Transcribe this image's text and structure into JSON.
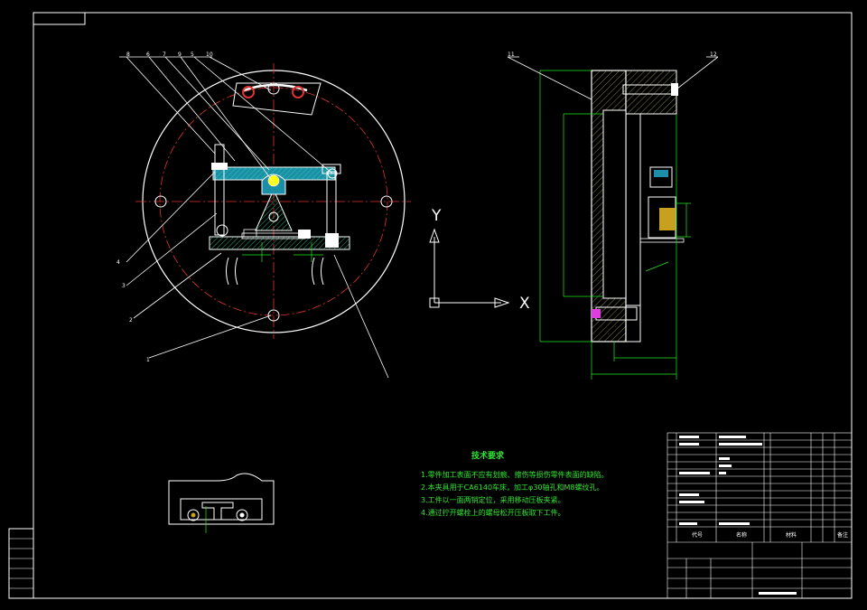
{
  "axis_labels": {
    "y": "Y",
    "x": "X"
  },
  "leaders_left": {
    "l8": "8",
    "l6": "6",
    "l7": "7",
    "l9": "9",
    "l5": "5",
    "l10": "10",
    "l4": "4",
    "l3": "3",
    "l2": "2",
    "l1": "1"
  },
  "leaders_right": {
    "l11": "11",
    "l12": "12"
  },
  "tech_notes": {
    "title": "技术要求",
    "lines": [
      "1.零件加工表面不应有划痕、擦伤等损伤零件表面的缺陷。",
      "2.本夹具用于CA6140车床，加工φ30轴孔和M8螺纹孔。",
      "3.工件以一面两销定位，采用移动压板夹紧。",
      "4.通过拧开螺栓上的螺母松开压板取下工件。"
    ]
  },
  "title_block": {
    "col_code": "代号",
    "col_name": "名称",
    "col_material": "材料",
    "col_remark": "备注"
  },
  "colors": {
    "bg": "#000000",
    "frame": "#ffffff",
    "dim": "#23e823",
    "center": "#e23131",
    "part": "#ffffff",
    "hatch": "#2fd8a0"
  }
}
